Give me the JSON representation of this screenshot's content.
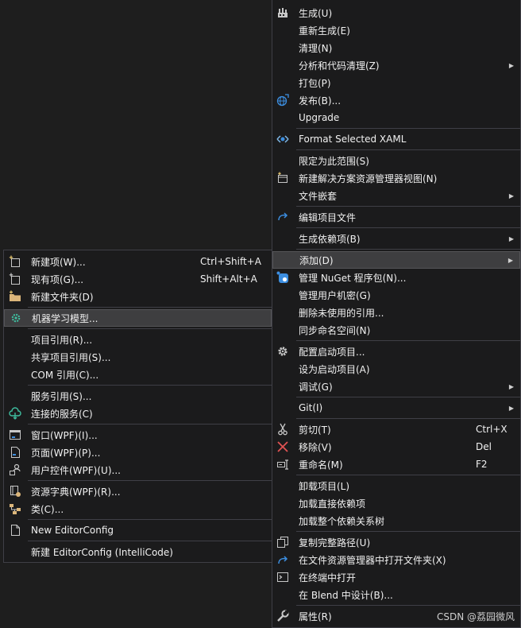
{
  "main_menu": {
    "build": "生成(U)",
    "rebuild": "重新生成(E)",
    "clean": "清理(N)",
    "analyze": "分析和代码清理(Z)",
    "pack": "打包(P)",
    "publish": "发布(B)...",
    "upgrade": "Upgrade",
    "format_xaml": "Format Selected XAML",
    "scope_to_this": "限定为此范围(S)",
    "new_solution_view": "新建解决方案资源管理器视图(N)",
    "file_nesting": "文件嵌套",
    "edit_project_file": "编辑项目文件",
    "build_dependencies": "生成依赖项(B)",
    "add": "添加(D)",
    "manage_nuget": "管理 NuGet 程序包(N)...",
    "manage_user_secrets": "管理用户机密(G)",
    "remove_unused_refs": "删除未使用的引用...",
    "sync_namespaces": "同步命名空间(N)",
    "configure_startup": "配置启动项目...",
    "set_startup": "设为启动项目(A)",
    "debug": "调试(G)",
    "git": "Git(I)",
    "cut": "剪切(T)",
    "cut_shortcut": "Ctrl+X",
    "remove": "移除(V)",
    "remove_shortcut": "Del",
    "rename": "重命名(M)",
    "rename_shortcut": "F2",
    "unload_project": "卸载项目(L)",
    "load_direct_deps": "加载直接依赖项",
    "load_entire_tree": "加载整个依赖关系树",
    "copy_full_path": "复制完整路径(U)",
    "open_in_explorer": "在文件资源管理器中打开文件夹(X)",
    "open_in_terminal": "在终端中打开",
    "design_in_blend": "在 Blend 中设计(B)...",
    "properties": "属性(R)"
  },
  "sub_menu": {
    "new_item": "新建项(W)...",
    "new_item_shortcut": "Ctrl+Shift+A",
    "existing_item": "现有项(G)...",
    "existing_item_shortcut": "Shift+Alt+A",
    "new_folder": "新建文件夹(D)",
    "ml_model": "机器学习模型...",
    "project_reference": "项目引用(R)...",
    "shared_project_reference": "共享项目引用(S)...",
    "com_reference": "COM 引用(C)...",
    "service_reference": "服务引用(S)...",
    "connected_service": "连接的服务(C)",
    "window_wpf": "窗口(WPF)(I)...",
    "page_wpf": "页面(WPF)(P)...",
    "user_control_wpf": "用户控件(WPF)(U)...",
    "resource_dictionary_wpf": "资源字典(WPF)(R)...",
    "class": "类(C)...",
    "new_editorconfig": "New EditorConfig",
    "new_editorconfig_intellicode": "新建 EditorConfig (IntelliCode)"
  },
  "watermark": "CSDN @荔园微风"
}
